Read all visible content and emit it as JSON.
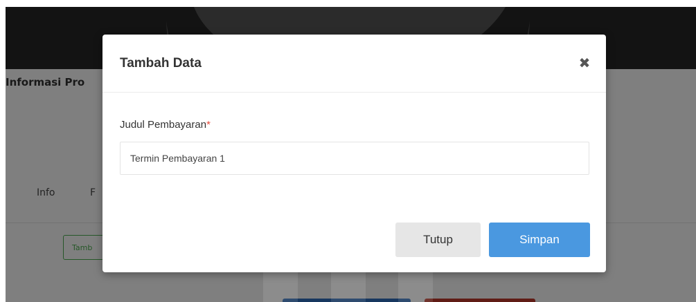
{
  "background": {
    "page_title": "Informasi Pro",
    "tabs": [
      {
        "label": "Info"
      },
      {
        "label": "F"
      }
    ],
    "add_button_label": "Tamb"
  },
  "modal": {
    "title": "Tambah Data",
    "close_icon": "close-icon",
    "field": {
      "label": "Judul Pembayaran",
      "required_mark": "*",
      "value": "Termin Pembayaran 1"
    },
    "buttons": {
      "close_label": "Tutup",
      "save_label": "Simpan"
    }
  },
  "colors": {
    "accent": "#4a98e0",
    "required": "#e74c3c",
    "topbar": "#262626"
  }
}
